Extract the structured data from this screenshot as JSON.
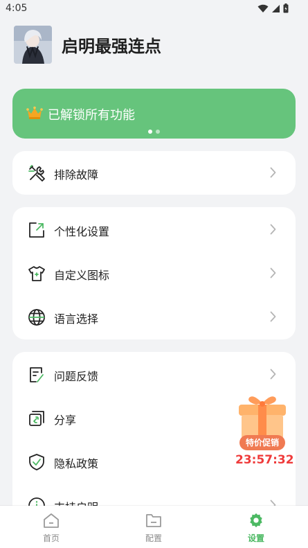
{
  "status_bar": {
    "time": "4:05"
  },
  "profile": {
    "app_title": "启明最强连点"
  },
  "banner": {
    "text": "已解锁所有功能",
    "page_dots": 2,
    "active_dot": 1
  },
  "cards": [
    {
      "items": [
        {
          "label": "排除故障",
          "icon": "tools-icon"
        }
      ]
    },
    {
      "items": [
        {
          "label": "个性化设置",
          "icon": "personalize-icon"
        },
        {
          "label": "自定义图标",
          "icon": "tshirt-icon"
        },
        {
          "label": "语言选择",
          "icon": "globe-icon"
        }
      ]
    },
    {
      "items": [
        {
          "label": "问题反馈",
          "icon": "feedback-icon"
        },
        {
          "label": "分享",
          "icon": "share-icon"
        },
        {
          "label": "隐私政策",
          "icon": "shield-check-icon"
        },
        {
          "label": "支持启明",
          "icon": "info-icon"
        }
      ]
    }
  ],
  "promo": {
    "tag": "特价促销",
    "countdown": "23:57:32"
  },
  "tabbar": {
    "items": [
      {
        "label": "首页",
        "icon": "home-icon"
      },
      {
        "label": "配置",
        "icon": "folder-icon"
      },
      {
        "label": "设置",
        "icon": "gear-icon"
      }
    ],
    "active_index": 2
  },
  "colors": {
    "accent": "#66c47c",
    "tab_active": "#4cb963",
    "countdown": "#ef3b3b",
    "background": "#f2f3f5"
  }
}
